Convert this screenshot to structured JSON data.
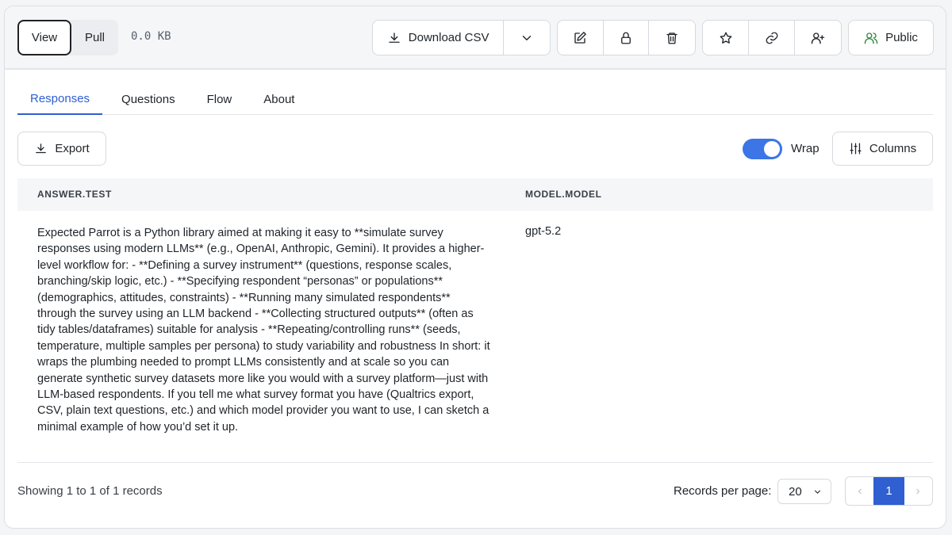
{
  "toolbar": {
    "view_label": "View",
    "pull_label": "Pull",
    "size": "0.0 KB",
    "download_label": "Download CSV",
    "public_label": "Public"
  },
  "tabs": [
    {
      "label": "Responses",
      "active": true
    },
    {
      "label": "Questions",
      "active": false
    },
    {
      "label": "Flow",
      "active": false
    },
    {
      "label": "About",
      "active": false
    }
  ],
  "actions": {
    "export_label": "Export",
    "wrap_label": "Wrap",
    "wrap_enabled": true,
    "columns_label": "Columns"
  },
  "table": {
    "columns": [
      "ANSWER.TEST",
      "MODEL.MODEL"
    ],
    "rows": [
      {
        "answer": "Expected Parrot is a Python library aimed at making it easy to **simulate survey responses using modern LLMs** (e.g., OpenAI, Anthropic, Gemini). It provides a higher-level workflow for: - **Defining a survey instrument** (questions, response scales, branching/skip logic, etc.) - **Specifying respondent “personas” or populations** (demographics, attitudes, constraints) - **Running many simulated respondents** through the survey using an LLM backend - **Collecting structured outputs** (often as tidy tables/dataframes) suitable for analysis - **Repeating/controlling runs** (seeds, temperature, multiple samples per persona) to study variability and robustness In short: it wraps the plumbing needed to prompt LLMs consistently and at scale so you can generate synthetic survey datasets more like you would with a survey platform—just with LLM-based respondents. If you tell me what survey format you have (Qualtrics export, CSV, plain text questions, etc.) and which model provider you want to use, I can sketch a minimal example of how you’d set it up.",
        "model": "gpt-5.2"
      }
    ]
  },
  "footer": {
    "showing": "Showing 1 to 1 of 1 records",
    "rpp_label": "Records per page:",
    "rpp_value": "20",
    "current_page": "1"
  },
  "colors": {
    "accent": "#2f5fd0",
    "public_green": "#2f8a3e",
    "toggle_on": "#3b75e6"
  }
}
